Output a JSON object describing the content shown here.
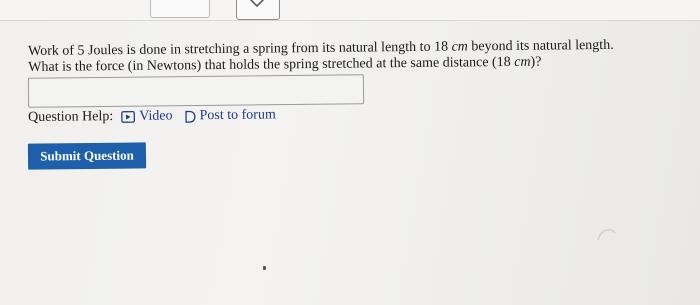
{
  "question": {
    "line1_part1": "Work of 5 Joules is done in stretching a spring from its natural length to 18 ",
    "line1_unit": "cm",
    "line1_part2": " beyond its natural length.",
    "line2_part1": "What is the force (in Newtons) that holds the spring stretched at the same distance (18 ",
    "line2_unit": "cm",
    "line2_part2": ")?"
  },
  "answer": {
    "value": ""
  },
  "help": {
    "label": "Question Help:",
    "video_label": "Video",
    "video_icon": "video-icon",
    "forum_label": "Post to forum",
    "forum_icon": "speech-bubble-icon"
  },
  "submit": {
    "label": "Submit Question"
  },
  "colors": {
    "link": "#1c3b8a",
    "submit_bg": "#1d5fa8"
  }
}
